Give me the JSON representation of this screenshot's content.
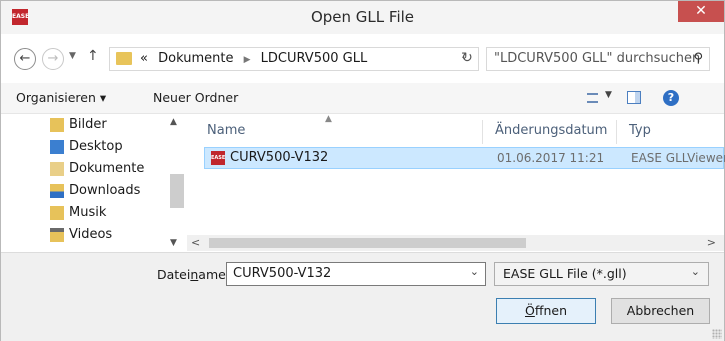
{
  "window": {
    "title": "Open GLL File",
    "app_icon_text": "EASE",
    "close_glyph": "✕"
  },
  "address_bar": {
    "overflow_glyph": "«",
    "breadcrumb": [
      "Dokumente",
      "LDCURV500 GLL"
    ],
    "search_placeholder": "\"LDCURV500 GLL\" durchsuchen"
  },
  "toolbar": {
    "organize_label": "Organisieren ▾",
    "new_folder_label": "Neuer Ordner"
  },
  "nav_pane": {
    "items": [
      {
        "label": "Bilder",
        "icon": "pictures-folder-icon"
      },
      {
        "label": "Desktop",
        "icon": "desktop-folder-icon"
      },
      {
        "label": "Dokumente",
        "icon": "documents-folder-icon"
      },
      {
        "label": "Downloads",
        "icon": "downloads-folder-icon"
      },
      {
        "label": "Musik",
        "icon": "music-folder-icon"
      },
      {
        "label": "Videos",
        "icon": "videos-folder-icon"
      }
    ]
  },
  "file_list": {
    "columns": {
      "name": "Name",
      "date": "Änderungsdatum",
      "type": "Typ"
    },
    "rows": [
      {
        "name": "CURV500-V132",
        "date": "01.06.2017 11:21",
        "type": "EASE GLLViewer",
        "selected": true
      }
    ]
  },
  "bottom": {
    "filename_label_pre": "Datei",
    "filename_label_u": "n",
    "filename_label_post": "ame:",
    "filename_value": "CURV500-V132",
    "filter_value": "EASE GLL File (*.gll)",
    "open_button_u": "Ö",
    "open_button_rest": "ffnen",
    "cancel_button": "Abbrechen"
  },
  "colors": {
    "selection": "#cce8ff",
    "accent": "#2f6fc4",
    "close": "#c7504f",
    "ease_red": "#c0262d"
  }
}
